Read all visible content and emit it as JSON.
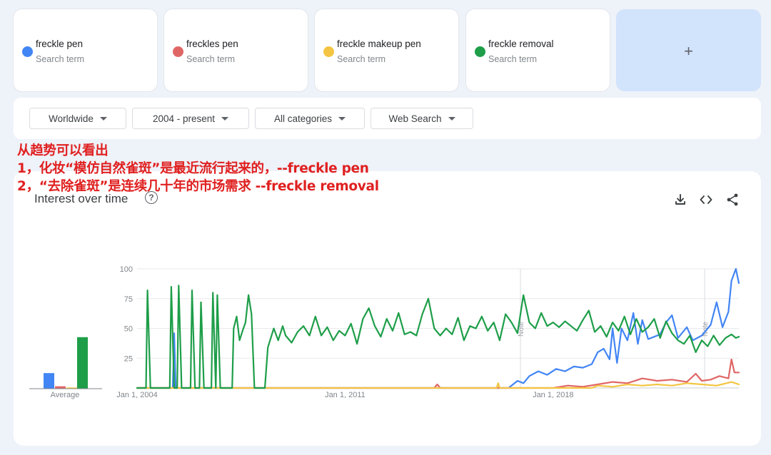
{
  "terms": [
    {
      "name": "freckle pen",
      "sub": "Search term",
      "color": "#4285f4"
    },
    {
      "name": "freckles pen",
      "sub": "Search term",
      "color": "#e06666"
    },
    {
      "name": "freckle makeup pen",
      "sub": "Search term",
      "color": "#f4c542"
    },
    {
      "name": "freckle removal",
      "sub": "Search term",
      "color": "#1e9e49"
    }
  ],
  "add_label": "+",
  "filters": [
    {
      "label": "Worldwide"
    },
    {
      "label": "2004 - present"
    },
    {
      "label": "All categories"
    },
    {
      "label": "Web Search"
    }
  ],
  "annotation": {
    "line1": "从趋势可以看出",
    "line2": "1，化妆“模仿自然雀斑”是最近流行起来的，--freckle pen",
    "line3": "2，“去除雀斑”是连续几十年的市场需求       --freckle removal"
  },
  "chart_title": "Interest over time",
  "help_glyph": "?",
  "icons": {
    "download": "download-icon",
    "embed": "embed-code-icon",
    "share": "share-icon"
  },
  "chart_data": {
    "type": "line",
    "x_range": [
      "2004-01",
      "2024-03"
    ],
    "x_ticks": [
      "Jan 1, 2004",
      "Jan 1, 2011",
      "Jan 1, 2018"
    ],
    "ylim": [
      0,
      100
    ],
    "y_ticks": [
      "100",
      "75",
      "50",
      "25"
    ],
    "notes": [
      "Note",
      "Note"
    ],
    "average_label": "Average",
    "averages": [
      13,
      2,
      1,
      43
    ],
    "series": [
      {
        "name": "freckle pen",
        "color": "#4285f4",
        "points": [
          [
            2004.0,
            0
          ],
          [
            2005.2,
            0
          ],
          [
            2005.25,
            46
          ],
          [
            2005.3,
            0
          ],
          [
            2006.0,
            0
          ],
          [
            2016.5,
            0
          ],
          [
            2016.8,
            6
          ],
          [
            2017.0,
            4
          ],
          [
            2017.2,
            10
          ],
          [
            2017.5,
            14
          ],
          [
            2017.8,
            11
          ],
          [
            2018.1,
            16
          ],
          [
            2018.4,
            14
          ],
          [
            2018.7,
            18
          ],
          [
            2019.0,
            17
          ],
          [
            2019.3,
            20
          ],
          [
            2019.5,
            30
          ],
          [
            2019.7,
            33
          ],
          [
            2019.9,
            24
          ],
          [
            2020.0,
            50
          ],
          [
            2020.15,
            21
          ],
          [
            2020.3,
            50
          ],
          [
            2020.5,
            40
          ],
          [
            2020.7,
            63
          ],
          [
            2020.85,
            37
          ],
          [
            2021.0,
            57
          ],
          [
            2021.2,
            41
          ],
          [
            2021.4,
            43
          ],
          [
            2021.6,
            45
          ],
          [
            2021.8,
            55
          ],
          [
            2022.0,
            61
          ],
          [
            2022.2,
            42
          ],
          [
            2022.5,
            51
          ],
          [
            2022.7,
            40
          ],
          [
            2023.0,
            44
          ],
          [
            2023.3,
            53
          ],
          [
            2023.5,
            72
          ],
          [
            2023.7,
            51
          ],
          [
            2023.9,
            64
          ],
          [
            2024.0,
            90
          ],
          [
            2024.15,
            100
          ],
          [
            2024.25,
            88
          ]
        ]
      },
      {
        "name": "freckles pen",
        "color": "#e06666",
        "points": [
          [
            2004.0,
            0
          ],
          [
            2014.0,
            0
          ],
          [
            2014.1,
            3
          ],
          [
            2014.2,
            0
          ],
          [
            2017.5,
            0
          ],
          [
            2018.0,
            0
          ],
          [
            2018.5,
            2
          ],
          [
            2019.0,
            1
          ],
          [
            2019.5,
            3
          ],
          [
            2020.0,
            5
          ],
          [
            2020.5,
            4
          ],
          [
            2021.0,
            8
          ],
          [
            2021.5,
            6
          ],
          [
            2022.0,
            7
          ],
          [
            2022.5,
            5
          ],
          [
            2022.8,
            12
          ],
          [
            2023.0,
            6
          ],
          [
            2023.3,
            7
          ],
          [
            2023.6,
            10
          ],
          [
            2023.9,
            8
          ],
          [
            2024.0,
            24
          ],
          [
            2024.1,
            13
          ],
          [
            2024.25,
            13
          ]
        ]
      },
      {
        "name": "freckle makeup pen",
        "color": "#f4c542",
        "points": [
          [
            2004.0,
            0
          ],
          [
            2016.1,
            0
          ],
          [
            2016.15,
            4
          ],
          [
            2016.2,
            0
          ],
          [
            2019.3,
            0
          ],
          [
            2019.5,
            2
          ],
          [
            2020.0,
            1
          ],
          [
            2020.5,
            3
          ],
          [
            2021.0,
            2
          ],
          [
            2021.5,
            3
          ],
          [
            2022.0,
            2
          ],
          [
            2022.5,
            4
          ],
          [
            2023.0,
            3
          ],
          [
            2023.5,
            2
          ],
          [
            2024.0,
            5
          ],
          [
            2024.25,
            3
          ]
        ]
      },
      {
        "name": "freckle removal",
        "color": "#1e9e49",
        "points": [
          [
            2004.0,
            0
          ],
          [
            2004.3,
            0
          ],
          [
            2004.35,
            82
          ],
          [
            2004.45,
            0
          ],
          [
            2005.1,
            0
          ],
          [
            2005.15,
            85
          ],
          [
            2005.25,
            0
          ],
          [
            2005.35,
            0
          ],
          [
            2005.4,
            86
          ],
          [
            2005.5,
            0
          ],
          [
            2005.8,
            0
          ],
          [
            2005.85,
            82
          ],
          [
            2005.95,
            0
          ],
          [
            2006.1,
            0
          ],
          [
            2006.15,
            72
          ],
          [
            2006.25,
            0
          ],
          [
            2006.5,
            0
          ],
          [
            2006.55,
            80
          ],
          [
            2006.65,
            0
          ],
          [
            2006.7,
            78
          ],
          [
            2006.8,
            0
          ],
          [
            2007.2,
            0
          ],
          [
            2007.25,
            50
          ],
          [
            2007.35,
            60
          ],
          [
            2007.45,
            40
          ],
          [
            2007.55,
            48
          ],
          [
            2007.65,
            55
          ],
          [
            2007.75,
            78
          ],
          [
            2007.85,
            62
          ],
          [
            2007.95,
            0
          ],
          [
            2008.3,
            0
          ],
          [
            2008.4,
            34
          ],
          [
            2008.6,
            50
          ],
          [
            2008.75,
            40
          ],
          [
            2008.9,
            52
          ],
          [
            2009.0,
            44
          ],
          [
            2009.2,
            38
          ],
          [
            2009.4,
            47
          ],
          [
            2009.6,
            52
          ],
          [
            2009.8,
            44
          ],
          [
            2010.0,
            60
          ],
          [
            2010.2,
            44
          ],
          [
            2010.4,
            51
          ],
          [
            2010.6,
            40
          ],
          [
            2010.8,
            48
          ],
          [
            2011.0,
            44
          ],
          [
            2011.2,
            54
          ],
          [
            2011.4,
            37
          ],
          [
            2011.6,
            58
          ],
          [
            2011.8,
            67
          ],
          [
            2012.0,
            52
          ],
          [
            2012.2,
            43
          ],
          [
            2012.4,
            58
          ],
          [
            2012.6,
            48
          ],
          [
            2012.8,
            63
          ],
          [
            2013.0,
            45
          ],
          [
            2013.2,
            47
          ],
          [
            2013.4,
            44
          ],
          [
            2013.6,
            62
          ],
          [
            2013.8,
            75
          ],
          [
            2014.0,
            50
          ],
          [
            2014.2,
            44
          ],
          [
            2014.4,
            50
          ],
          [
            2014.6,
            45
          ],
          [
            2014.8,
            59
          ],
          [
            2015.0,
            40
          ],
          [
            2015.2,
            52
          ],
          [
            2015.4,
            50
          ],
          [
            2015.6,
            60
          ],
          [
            2015.8,
            48
          ],
          [
            2016.0,
            55
          ],
          [
            2016.2,
            40
          ],
          [
            2016.4,
            62
          ],
          [
            2016.6,
            55
          ],
          [
            2016.8,
            46
          ],
          [
            2017.0,
            78
          ],
          [
            2017.2,
            55
          ],
          [
            2017.4,
            50
          ],
          [
            2017.6,
            63
          ],
          [
            2017.8,
            52
          ],
          [
            2018.0,
            55
          ],
          [
            2018.2,
            51
          ],
          [
            2018.4,
            56
          ],
          [
            2018.6,
            52
          ],
          [
            2018.8,
            48
          ],
          [
            2019.0,
            57
          ],
          [
            2019.2,
            65
          ],
          [
            2019.4,
            47
          ],
          [
            2019.6,
            52
          ],
          [
            2019.8,
            43
          ],
          [
            2020.0,
            55
          ],
          [
            2020.2,
            48
          ],
          [
            2020.4,
            60
          ],
          [
            2020.6,
            45
          ],
          [
            2020.8,
            58
          ],
          [
            2021.0,
            47
          ],
          [
            2021.2,
            51
          ],
          [
            2021.4,
            58
          ],
          [
            2021.6,
            42
          ],
          [
            2021.8,
            56
          ],
          [
            2022.0,
            46
          ],
          [
            2022.2,
            40
          ],
          [
            2022.4,
            37
          ],
          [
            2022.6,
            44
          ],
          [
            2022.8,
            30
          ],
          [
            2023.0,
            40
          ],
          [
            2023.2,
            35
          ],
          [
            2023.4,
            44
          ],
          [
            2023.6,
            36
          ],
          [
            2023.8,
            42
          ],
          [
            2024.0,
            45
          ],
          [
            2024.15,
            42
          ],
          [
            2024.25,
            43
          ]
        ]
      }
    ]
  }
}
